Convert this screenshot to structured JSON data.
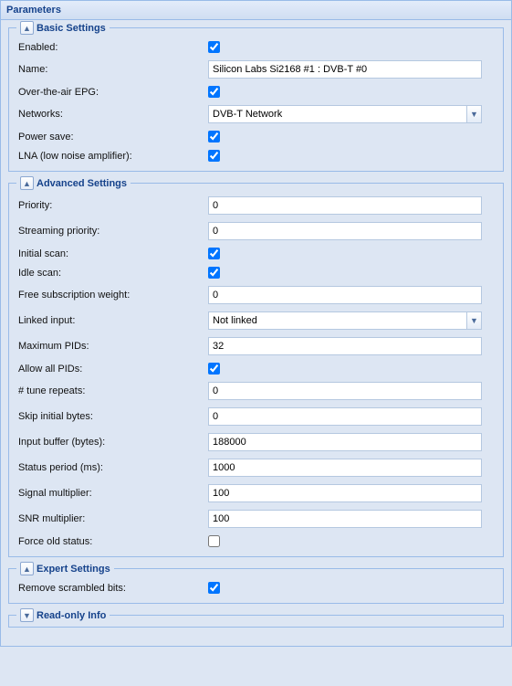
{
  "panel": {
    "title": "Parameters"
  },
  "groups": {
    "basic": {
      "title": "Basic Settings"
    },
    "advanced": {
      "title": "Advanced Settings"
    },
    "expert": {
      "title": "Expert Settings"
    },
    "readonly": {
      "title": "Read-only Info"
    }
  },
  "labels": {
    "enabled": "Enabled:",
    "name": "Name:",
    "epg": "Over-the-air EPG:",
    "networks": "Networks:",
    "powersave": "Power save:",
    "lna": "LNA (low noise amplifier):",
    "priority": "Priority:",
    "streamprio": "Streaming priority:",
    "initscan": "Initial scan:",
    "idlescan": "Idle scan:",
    "freesub": "Free subscription weight:",
    "linked": "Linked input:",
    "maxpids": "Maximum PIDs:",
    "allowpids": "Allow all PIDs:",
    "tunerep": "# tune repeats:",
    "skipbytes": "Skip initial bytes:",
    "inputbuf": "Input buffer (bytes):",
    "statusper": "Status period (ms):",
    "sigmult": "Signal multiplier:",
    "snrmult": "SNR multiplier:",
    "forceold": "Force old status:",
    "removescr": "Remove scrambled bits:"
  },
  "values": {
    "name": "Silicon Labs Si2168 #1 : DVB-T #0",
    "networks": "DVB-T Network",
    "priority": "0",
    "streamprio": "0",
    "freesub": "0",
    "linked": "Not linked",
    "maxpids": "32",
    "tunerep": "0",
    "skipbytes": "0",
    "inputbuf": "188000",
    "statusper": "1000",
    "sigmult": "100",
    "snrmult": "100"
  }
}
